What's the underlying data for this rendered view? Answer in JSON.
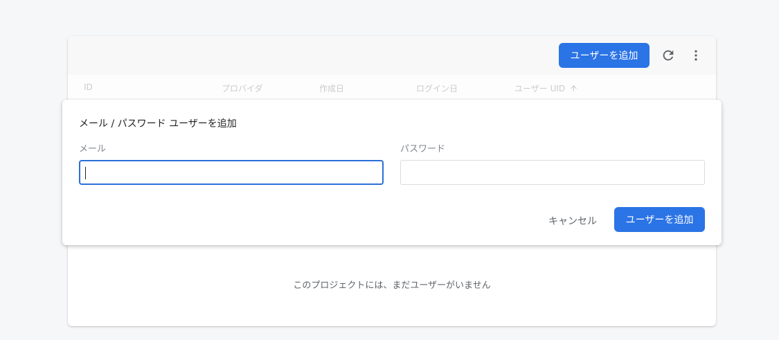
{
  "toolbar": {
    "add_user_label": "ユーザーを追加"
  },
  "table": {
    "columns": [
      "ID",
      "プロバイダ",
      "作成日",
      "ログイン日",
      "ユーザー UID"
    ],
    "empty_message": "このプロジェクトには、まだユーザーがいません"
  },
  "dialog": {
    "title": "メール / パスワード ユーザーを追加",
    "email_label": "メール",
    "email_value": "",
    "password_label": "パスワード",
    "password_value": "",
    "cancel_label": "キャンセル",
    "submit_label": "ユーザーを追加"
  },
  "icons": {
    "refresh": "refresh-icon",
    "more": "more-vert-icon",
    "sort": "arrow-up-icon"
  },
  "colors": {
    "primary": "#2b74e6",
    "focus": "#2b6fd6"
  }
}
